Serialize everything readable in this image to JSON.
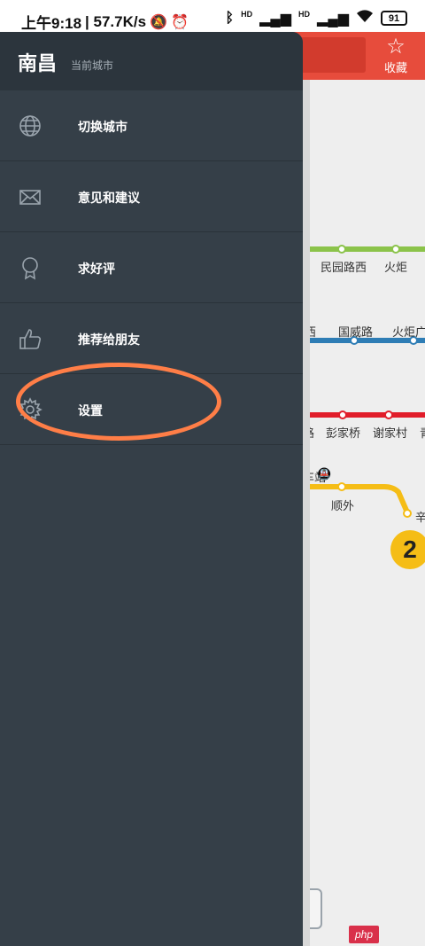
{
  "status_bar": {
    "time": "上午9:18",
    "network_speed": "| 57.7K/s",
    "battery_level": "91",
    "hd1": "HD",
    "hd2": "HD"
  },
  "map": {
    "favorite_label": "收藏",
    "stations": {
      "minyuanluxi": "民园路西",
      "huoju": "火炬",
      "xi": "西",
      "guoweilu": "国威路",
      "huojuguang": "火炬广",
      "lu": "路",
      "pengjiaqiao": "彭家桥",
      "xiejiacun": "谢家村",
      "qing": "青",
      "chezhan": "车站",
      "shunwai": "顺外",
      "xin": "辛"
    },
    "line_badge": "2",
    "colors": {
      "header": "#e74c3c",
      "line_green": "#8bc34a",
      "line_blue": "#2e7db5",
      "line_red": "#e11d2a",
      "line_yellow": "#f5bd16"
    }
  },
  "drawer": {
    "city": "南昌",
    "city_sub": "当前城市",
    "items": [
      {
        "label": "切换城市",
        "icon": "globe-icon"
      },
      {
        "label": "意见和建议",
        "icon": "envelope-icon"
      },
      {
        "label": "求好评",
        "icon": "award-icon"
      },
      {
        "label": "推荐给朋友",
        "icon": "thumbs-up-icon"
      },
      {
        "label": "设置",
        "icon": "gear-icon"
      }
    ],
    "colors": {
      "background": "#353f48",
      "header": "#2c353d"
    }
  },
  "annotation": {
    "color": "#ff7e47"
  },
  "watermark": "php"
}
